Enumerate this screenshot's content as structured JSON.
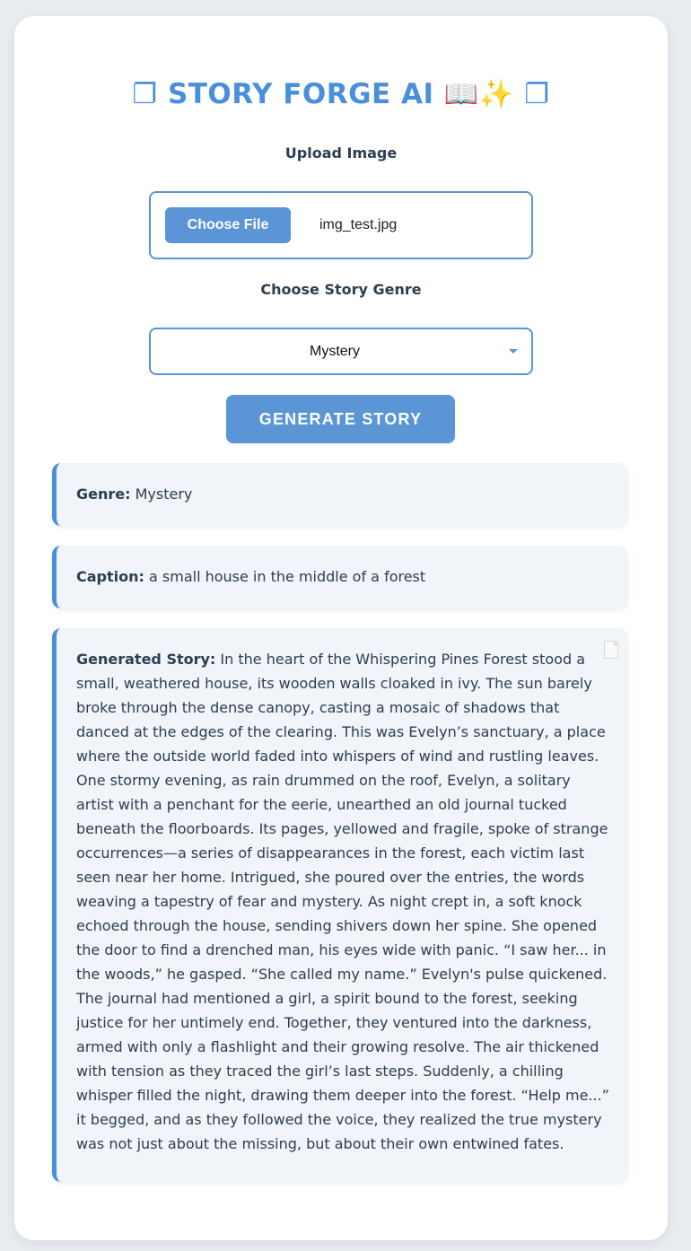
{
  "app": {
    "title": "❐ STORY FORGE AI 📖✨ ❐"
  },
  "upload": {
    "label": "Upload Image",
    "button_label": "Choose File",
    "file_name": "img_test.jpg"
  },
  "genre_select": {
    "label": "Choose Story Genre",
    "selected": "Mystery"
  },
  "generate_button": {
    "label": "GENERATE STORY"
  },
  "results": {
    "genre_label": "Genre:",
    "genre_value": "Mystery",
    "caption_label": "Caption:",
    "caption_value": "a small house in the middle of a forest",
    "story_label": "Generated Story:",
    "story_text": "In the heart of the Whispering Pines Forest stood a small, weathered house, its wooden walls cloaked in ivy. The sun barely broke through the dense canopy, casting a mosaic of shadows that danced at the edges of the clearing. This was Evelyn’s sanctuary, a place where the outside world faded into whispers of wind and rustling leaves. One stormy evening, as rain drummed on the roof, Evelyn, a solitary artist with a penchant for the eerie, unearthed an old journal tucked beneath the floorboards. Its pages, yellowed and fragile, spoke of strange occurrences—a series of disappearances in the forest, each victim last seen near her home. Intrigued, she poured over the entries, the words weaving a tapestry of fear and mystery. As night crept in, a soft knock echoed through the house, sending shivers down her spine. She opened the door to find a drenched man, his eyes wide with panic. “I saw her... in the woods,” he gasped. “She called my name.” Evelyn's pulse quickened. The journal had mentioned a girl, a spirit bound to the forest, seeking justice for her untimely end. Together, they ventured into the darkness, armed with only a flashlight and their growing resolve. The air thickened with tension as they traced the girl’s last steps. Suddenly, a chilling whisper filled the night, drawing them deeper into the forest. “Help me...” it begged, and as they followed the voice, they realized the true mystery was not just about the missing, but about their own entwined fates."
  },
  "icons": {
    "caret": "chevron-down-icon",
    "document": "document-icon"
  },
  "colors": {
    "accent": "#4a90d9",
    "button": "#5b95d6",
    "panel_bg": "#f1f4f8",
    "text": "#2c3e50"
  }
}
